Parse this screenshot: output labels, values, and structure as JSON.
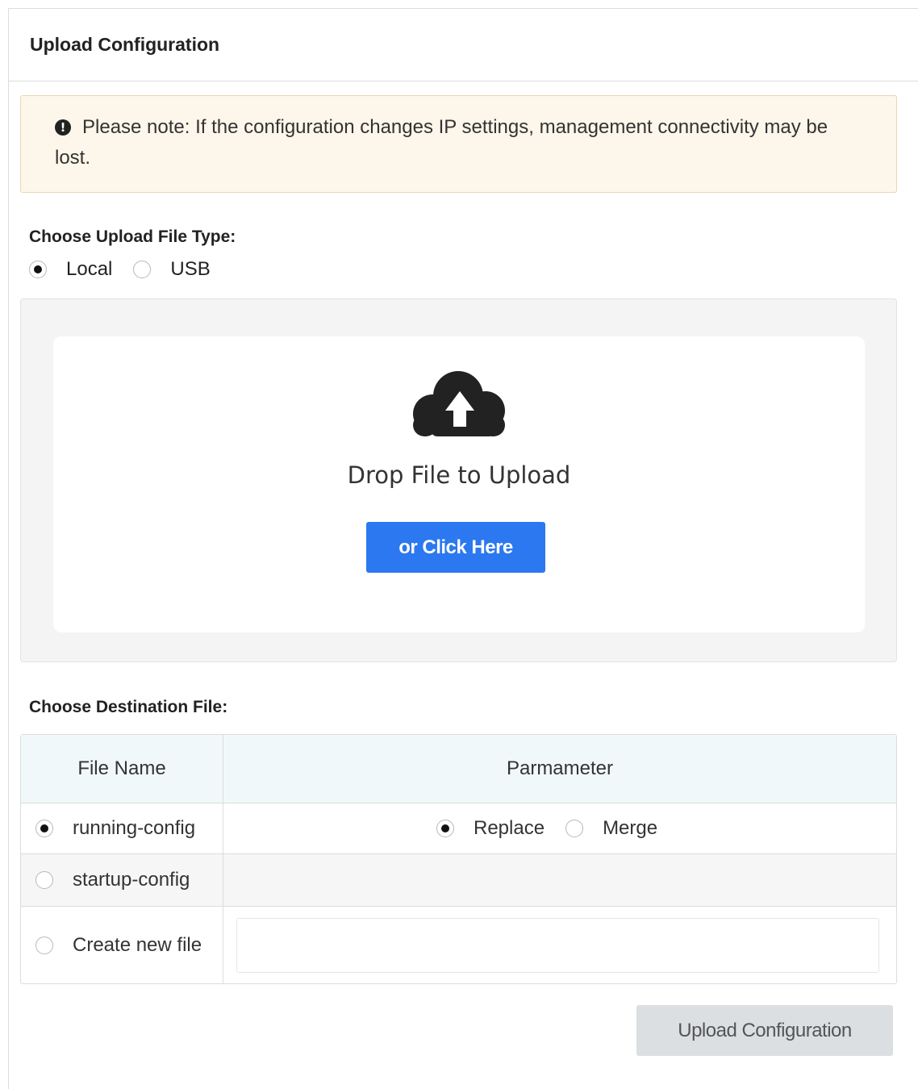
{
  "header": {
    "title": "Upload Configuration"
  },
  "alert": {
    "icon": "exclamation-circle-icon",
    "icon_glyph": "!",
    "text": "Please note: If the configuration changes IP settings, management connectivity may be lost."
  },
  "file_type": {
    "label": "Choose Upload File Type:",
    "options": [
      {
        "label": "Local",
        "selected": true
      },
      {
        "label": "USB",
        "selected": false
      }
    ]
  },
  "dropzone": {
    "icon": "cloud-upload-icon",
    "text": "Drop File to Upload",
    "button_label": "or Click Here"
  },
  "destination": {
    "label": "Choose Destination File:",
    "columns": [
      "File Name",
      "Parmameter"
    ],
    "rows": [
      {
        "name": "running-config",
        "selected": true,
        "params": [
          {
            "label": "Replace",
            "selected": true
          },
          {
            "label": "Merge",
            "selected": false
          }
        ]
      },
      {
        "name": "startup-config",
        "selected": false
      },
      {
        "name": "Create new file",
        "selected": false,
        "input_value": "",
        "input_placeholder": ""
      }
    ]
  },
  "submit": {
    "label": "Upload Configuration"
  },
  "colors": {
    "primary": "#2b78f0",
    "alert_bg": "#fdf6ea",
    "table_header_bg": "#f1f8fa",
    "disabled_button_bg": "#dcdfe2"
  }
}
